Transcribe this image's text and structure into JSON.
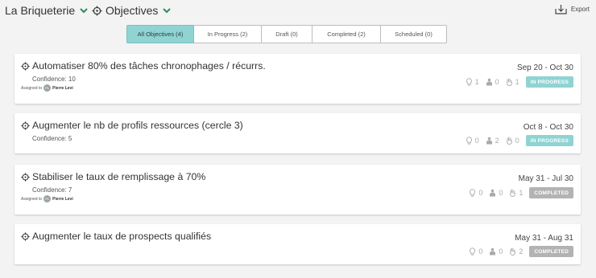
{
  "header": {
    "org_name": "La Briqueterie",
    "section_name": "Objectives",
    "export_label": "Export"
  },
  "tabs": [
    {
      "label": "All Objectives (4)",
      "active": true
    },
    {
      "label": "In Progress (2)",
      "active": false
    },
    {
      "label": "Draft (0)",
      "active": false
    },
    {
      "label": "Completed (2)",
      "active": false
    },
    {
      "label": "Scheduled (0)",
      "active": false
    }
  ],
  "objectives": [
    {
      "title": "Automatiser 80% des tâches chronophages / récurrs.",
      "confidence": "Confidence: 10",
      "assigned_label": "Assigned to",
      "assignee_initials": "PL",
      "assignee_name": "Pierre Levi",
      "dates": "Sep 20 - Oct 30",
      "ideas": "1",
      "people": "0",
      "votes": "1",
      "status": "IN PROGRESS"
    },
    {
      "title": "Augmenter le nb de profils ressources (cercle 3)",
      "confidence": "Confidence: 5",
      "dates": "Oct 8 - Oct 30",
      "ideas": "0",
      "people": "2",
      "votes": "0",
      "status": "IN PROGRESS"
    },
    {
      "title": "Stabiliser le taux de remplissage à 70%",
      "confidence": "Confidence: 7",
      "assigned_label": "Assigned to",
      "assignee_initials": "PL",
      "assignee_name": "Pierre Levi",
      "dates": "May 31 - Jul 30",
      "ideas": "0",
      "people": "0",
      "votes": "1",
      "status": "COMPLETED"
    },
    {
      "title": "Augmenter le taux de prospects qualifiés",
      "dates": "May 31 - Aug 31",
      "ideas": "0",
      "people": "0",
      "votes": "2",
      "status": "COMPLETED"
    }
  ],
  "colors": {
    "accent": "#8fd3d3",
    "in_progress": "#8fd3d3",
    "completed": "#b3b3b3",
    "chevron": "#2e8b57"
  }
}
